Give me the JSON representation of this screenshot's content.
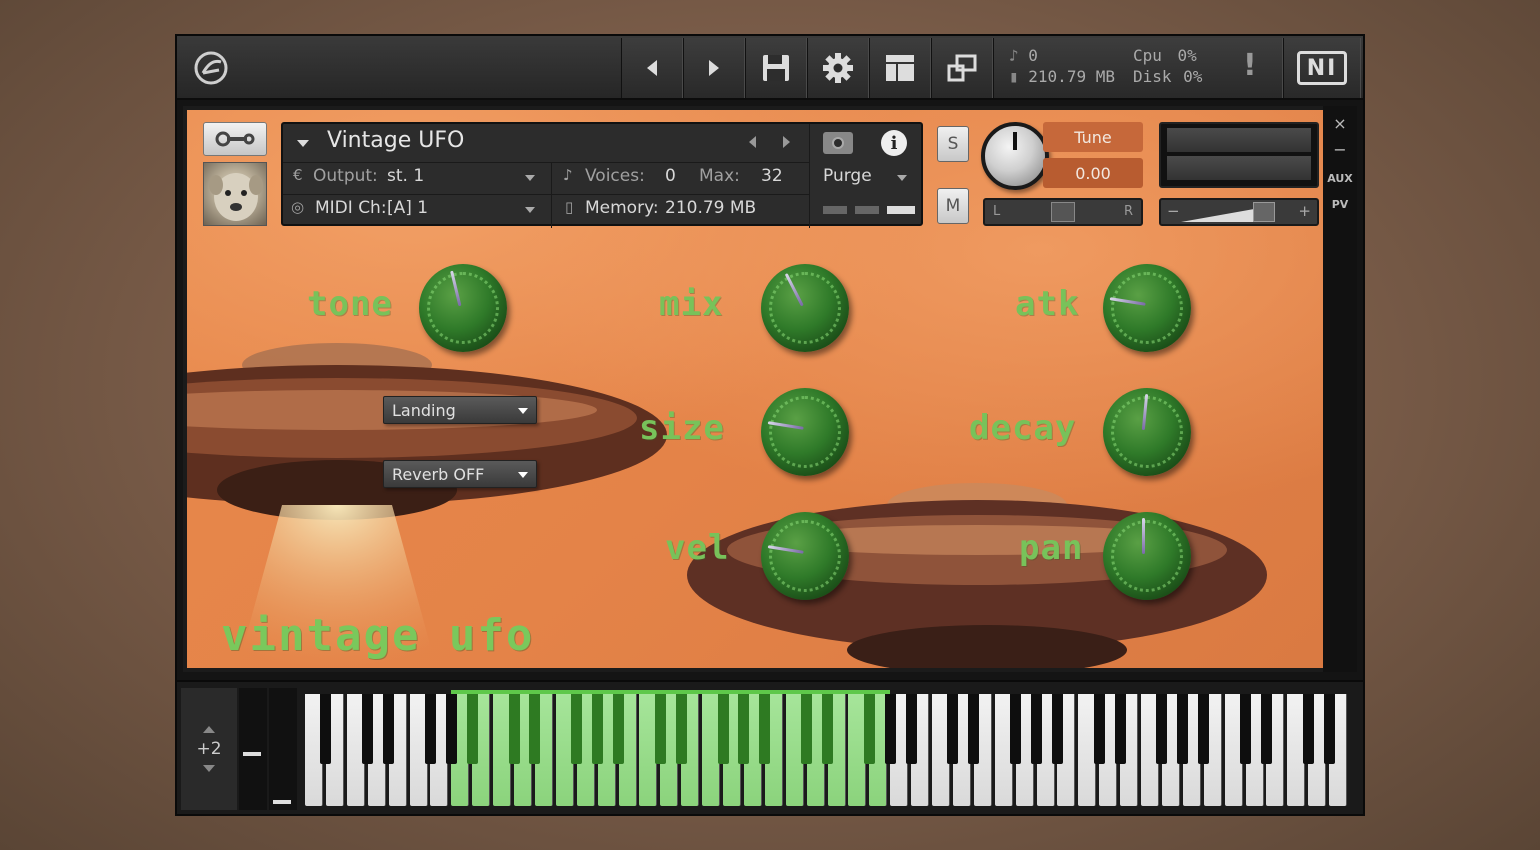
{
  "toolbar": {
    "voices_count": "0",
    "memory": "210.79 MB",
    "cpu_label": "Cpu",
    "cpu_value": "0%",
    "disk_label": "Disk",
    "disk_value": "0%",
    "alert": "!",
    "brand": "NI",
    "icons": [
      "kontakt-logo-icon",
      "prev-arrow-icon",
      "next-arrow-icon",
      "save-icon",
      "gear-icon",
      "layout-icon",
      "resize-icon",
      "alert-icon",
      "ni-logo-icon"
    ]
  },
  "instrument": {
    "name": "Vintage UFO",
    "output_label": "Output:",
    "output_value": "st. 1",
    "voices_label": "Voices:",
    "voices_value": "0",
    "max_label": "Max:",
    "max_value": "32",
    "purge_label": "Purge",
    "midi_label": "MIDI Ch:",
    "midi_value": "[A]  1",
    "memory_label": "Memory:",
    "memory_value": "210.79 MB",
    "solo": "S",
    "mute": "M",
    "tune_label": "Tune",
    "tune_value": "0.00",
    "pan_left": "L",
    "pan_right": "R",
    "vol_minus": "−",
    "vol_plus": "+",
    "aux": "AUX",
    "pv": "PV",
    "close": "×",
    "minimize": "−"
  },
  "panel": {
    "title": "vintage ufo",
    "knobs": [
      {
        "label": "tone",
        "value": 0.45
      },
      {
        "label": "mix",
        "value": 0.4
      },
      {
        "label": "atk",
        "value": 0.2
      },
      {
        "label": "size",
        "value": 0.2
      },
      {
        "label": "decay",
        "value": 0.52
      },
      {
        "label": "vel",
        "value": 0.2
      },
      {
        "label": "pan",
        "value": 0.5
      }
    ],
    "dropdowns": [
      {
        "value": "Landing"
      },
      {
        "value": "Reverb OFF"
      }
    ]
  },
  "keyboard": {
    "octave_shift": "+2",
    "active_range": "green keys"
  },
  "colors": {
    "panel_bg": "#e48348",
    "knob_green": "#2f7a29",
    "label_green": "#78c25a",
    "active_key": "#8bd37c"
  }
}
